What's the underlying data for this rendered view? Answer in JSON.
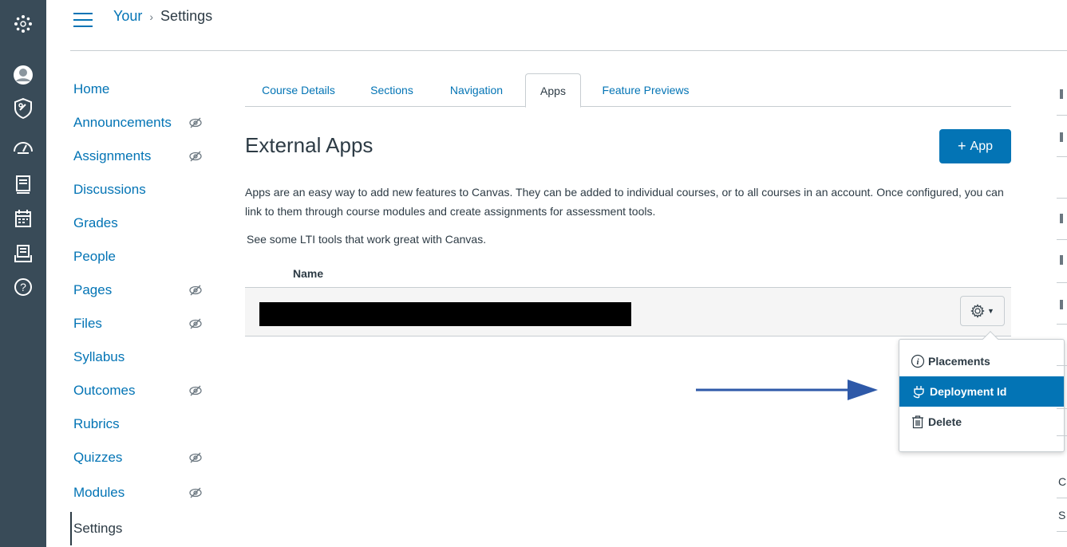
{
  "breadcrumb": {
    "link": "Your",
    "separator": "›",
    "current": "Settings"
  },
  "course_nav": [
    {
      "label": "Home",
      "hidden": false
    },
    {
      "label": "Announcements",
      "hidden": true
    },
    {
      "label": "Assignments",
      "hidden": true
    },
    {
      "label": "Discussions",
      "hidden": false
    },
    {
      "label": "Grades",
      "hidden": false
    },
    {
      "label": "People",
      "hidden": false
    },
    {
      "label": "Pages",
      "hidden": true
    },
    {
      "label": "Files",
      "hidden": true
    },
    {
      "label": "Syllabus",
      "hidden": false
    },
    {
      "label": "Outcomes",
      "hidden": true
    },
    {
      "label": "Rubrics",
      "hidden": false
    },
    {
      "label": "Quizzes",
      "hidden": true
    },
    {
      "label": "Modules",
      "hidden": true
    },
    {
      "label": "Settings",
      "hidden": false,
      "active": true
    }
  ],
  "tabs": [
    "Course Details",
    "Sections",
    "Navigation",
    "Apps",
    "Feature Previews"
  ],
  "active_tab": "Apps",
  "main": {
    "title": "External Apps",
    "add_button": {
      "icon": "+",
      "label": "App"
    },
    "description": "Apps are an easy way to add new features to Canvas. They can be added to individual courses, or to all courses in an account. Once configured, you can link to them through course modules and create assignments for assessment tools.",
    "lti_link": "See some LTI tools that work great with Canvas.",
    "table_header": "Name"
  },
  "menu": {
    "items": [
      {
        "label": "Placements",
        "icon": "info-icon"
      },
      {
        "label": "Deployment Id",
        "icon": "plug-icon",
        "selected": true
      },
      {
        "label": "Delete",
        "icon": "trash-icon"
      }
    ]
  },
  "right_strip": {
    "letters": [
      "C",
      "S"
    ]
  },
  "colors": {
    "brand": "#0374b5",
    "global_nav": "#394b58",
    "text": "#2d3b45",
    "annotation_arrow": "#2e59a8"
  }
}
